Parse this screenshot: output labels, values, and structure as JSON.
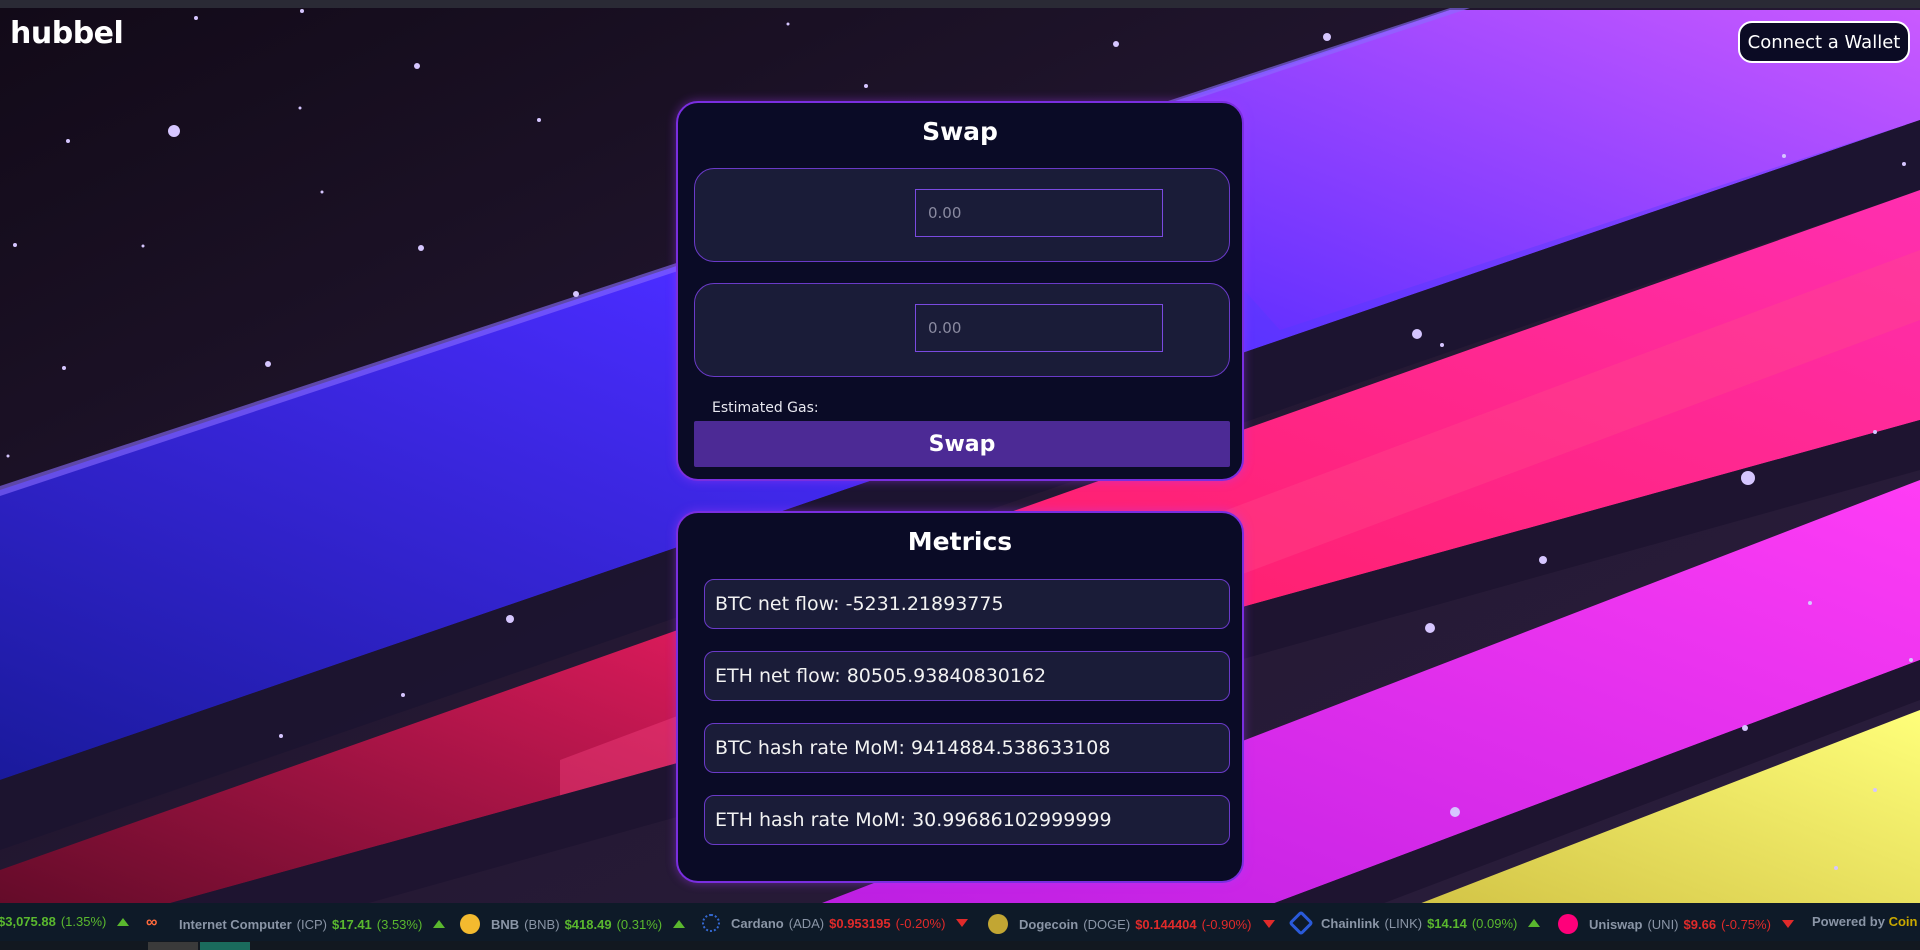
{
  "app": {
    "logo": "hubbel"
  },
  "header": {
    "wallet_button": "Connect a Wallet"
  },
  "swap": {
    "title": "Swap",
    "from_placeholder": "0.00",
    "to_placeholder": "0.00",
    "gas_label": "Estimated Gas:",
    "button_label": "Swap"
  },
  "metrics": {
    "title": "Metrics",
    "items": [
      "BTC net flow: -5231.21893775",
      "ETH net flow: 80505.93840830162",
      "BTC hash rate  MoM: 9414884.538633108",
      "ETH hash rate  MoM: 30.99686102999999"
    ]
  },
  "ticker": {
    "items": [
      {
        "name": "",
        "symbol": "",
        "price": "$3,075.88",
        "change": "(1.35%)",
        "direction": "up",
        "icon": ""
      },
      {
        "name": "Internet Computer",
        "symbol": "(ICP)",
        "price": "$17.41",
        "change": "(3.53%)",
        "direction": "up",
        "icon": "infinity-icon"
      },
      {
        "name": "BNB",
        "symbol": "(BNB)",
        "price": "$418.49",
        "change": "(0.31%)",
        "direction": "up",
        "icon": "bnb-icon"
      },
      {
        "name": "Cardano",
        "symbol": "(ADA)",
        "price": "$0.953195",
        "change": "(-0.20%)",
        "direction": "down",
        "icon": "cardano-icon"
      },
      {
        "name": "Dogecoin",
        "symbol": "(DOGE)",
        "price": "$0.144404",
        "change": "(-0.90%)",
        "direction": "down",
        "icon": "dogecoin-icon"
      },
      {
        "name": "Chainlink",
        "symbol": "(LINK)",
        "price": "$14.14",
        "change": "(0.09%)",
        "direction": "up",
        "icon": "chainlink-icon"
      },
      {
        "name": "Uniswap",
        "symbol": "(UNI)",
        "price": "$9.66",
        "change": "(-0.75%)",
        "direction": "down",
        "icon": "uniswap-icon"
      }
    ],
    "powered_by": "Powered by",
    "powered_brand": "Coin"
  },
  "colors": {
    "card_bg": "#0a0b26",
    "card_border": "#7a2ee0",
    "swap_button": "#4c2a95",
    "up": "#5ab82e",
    "down": "#e02a2a"
  }
}
